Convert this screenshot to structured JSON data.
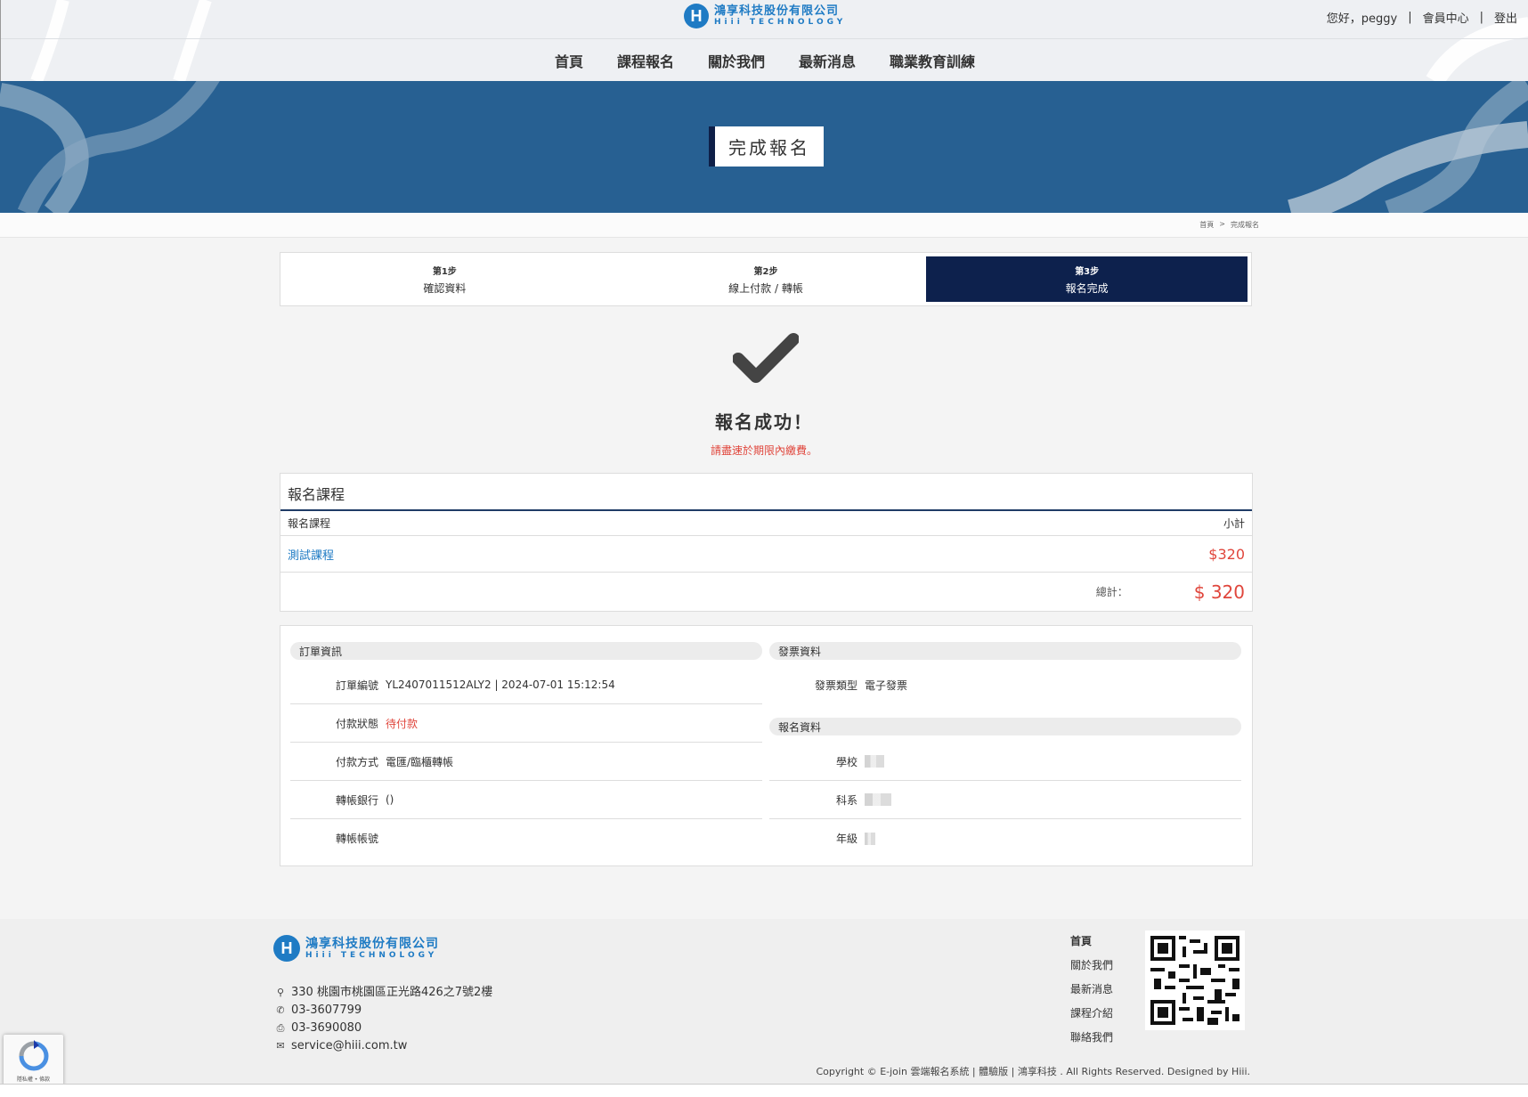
{
  "header": {
    "logo_cn": "鴻享科技股份有限公司",
    "logo_en": "Hiii TECHNOLOGY",
    "logo_letter": "H",
    "greeting": "您好，peggy",
    "member_center": "會員中心",
    "logout": "登出",
    "nav": [
      "首頁",
      "課程報名",
      "關於我們",
      "最新消息",
      "職業教育訓練"
    ]
  },
  "banner": {
    "title": "完成報名"
  },
  "breadcrumb": {
    "home": "首頁",
    "sep": ">",
    "current": "完成報名"
  },
  "steps": [
    {
      "num": "第1步",
      "name": "確認資料",
      "active": false
    },
    {
      "num": "第2步",
      "name": "線上付款 / 轉帳",
      "active": false
    },
    {
      "num": "第3步",
      "name": "報名完成",
      "active": true
    }
  ],
  "success": {
    "title": "報名成功！",
    "note": "請盡速於期限內繳費。"
  },
  "course": {
    "box_title": "報名課程",
    "col_course": "報名課程",
    "col_subtotal": "小計",
    "rows": [
      {
        "name": "測試課程",
        "price": "$320"
      }
    ],
    "total_label": "總計：",
    "total_value": "$ 320"
  },
  "order": {
    "section_title": "訂單資訊",
    "order_no_label": "訂單編號",
    "order_no_value": "YL2407011512ALY2 | 2024-07-01 15:12:54",
    "status_label": "付款狀態",
    "status_value": "待付款",
    "method_label": "付款方式",
    "method_value": "電匯/臨櫃轉帳",
    "bank_label": "轉帳銀行",
    "bank_value": "()",
    "account_label": "轉帳帳號",
    "account_value": ""
  },
  "invoice": {
    "section_title": "發票資料",
    "type_label": "發票類型",
    "type_value": "電子發票"
  },
  "registration": {
    "section_title": "報名資料",
    "school_label": "學校",
    "dept_label": "科系",
    "grade_label": "年級"
  },
  "footer": {
    "logo_cn": "鴻享科技股份有限公司",
    "logo_en": "Hiii TECHNOLOGY",
    "address": "330 桃園市桃園區正光路426之7號2樓",
    "phone": "03-3607799",
    "fax": "03-3690080",
    "email": "service@hiii.com.tw",
    "links": [
      "首頁",
      "關於我們",
      "最新消息",
      "課程介紹",
      "聯絡我們"
    ],
    "copyright": "Copyright © E-join 雲端報名系統 | 體驗版 | 鴻享科技 . All Rights Reserved. Designed by Hiii."
  },
  "recaptcha": {
    "text": "隱私權 • 條款"
  },
  "colors": {
    "brand": "#1f7bc4",
    "banner": "#276092",
    "active_step": "#0d214d",
    "alert": "#e0463c"
  }
}
